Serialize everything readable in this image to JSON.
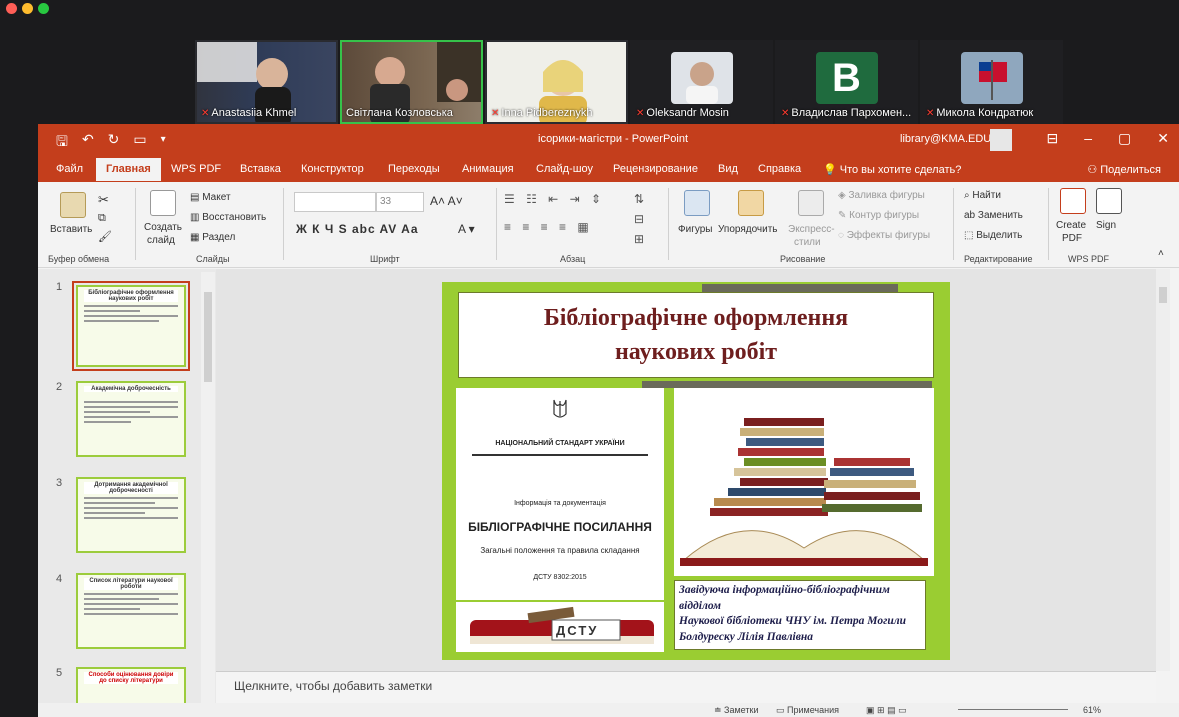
{
  "colors": {
    "ppt_accent": "#c43e1c",
    "slide_green": "#9acd32",
    "title_red": "#6e1e1e",
    "mic_off": "#ff3b30",
    "speaker_border": "#36c24a"
  },
  "participants": [
    {
      "name": "Anastasiia Khmel",
      "muted": true,
      "type": "video",
      "active": false
    },
    {
      "name": "Світлана Козловська",
      "muted": false,
      "type": "video",
      "active": true
    },
    {
      "name": "Inna Pidbereznykh",
      "muted": true,
      "type": "video",
      "active": false
    },
    {
      "name": "Oleksandr Mosin",
      "muted": true,
      "type": "photo",
      "active": false
    },
    {
      "name": "Владислав Пархомен...",
      "muted": true,
      "type": "initial",
      "initial": "B",
      "active": false
    },
    {
      "name": "Микола Кондратюк",
      "muted": true,
      "type": "photo-flag",
      "active": false
    }
  ],
  "ppt": {
    "doc_title": "ісорики-магістри - PowerPoint",
    "account": "library@KMA.EDU",
    "tabs": [
      "Файл",
      "Главная",
      "WPS PDF",
      "Вставка",
      "Конструктор",
      "Переходы",
      "Анимация",
      "Слайд-шоу",
      "Рецензирование",
      "Вид",
      "Справка"
    ],
    "active_tab": "Главная",
    "tell_me": "Что вы хотите сделать?",
    "share": "Поделиться",
    "ribbon": {
      "paste": "Вставить",
      "clipboard": "Буфер обмена",
      "new_slide_1": "Создать",
      "new_slide_2": "слайд",
      "layout": "Макет",
      "reset": "Восстановить",
      "section": "Раздел",
      "slides": "Слайды",
      "font_size": "33",
      "font": "Шрифт",
      "format_letters": "Ж  К  Ч  S  abc  AV  Aa",
      "paragraph": "Абзац",
      "shapes": "Фигуры",
      "arrange": "Упорядочить",
      "express_1": "Экспресс-",
      "express_2": "стили",
      "fill": "Заливка фигуры",
      "outline": "Контур фигуры",
      "effects": "Эффекты фигуры",
      "drawing": "Рисование",
      "find": "Найти",
      "replace": "Заменить",
      "select": "Выделить",
      "editing": "Редактирование",
      "create_pdf_1": "Create",
      "create_pdf_2": "PDF",
      "sign": "Sign",
      "wps_pdf": "WPS PDF"
    },
    "thumbnails": [
      {
        "num": "1",
        "title": "Бібліографічне оформлення наукових робіт"
      },
      {
        "num": "2",
        "title": "Академічна доброчесність"
      },
      {
        "num": "3",
        "title": "Дотримання академічної доброчесності"
      },
      {
        "num": "4",
        "title": "Список літератури наукової роботи"
      },
      {
        "num": "5",
        "title": "Способи оцінювання довіри до списку літератури"
      }
    ],
    "slide": {
      "title_line1": "Бібліографічне оформлення",
      "title_line2": "наукових робіт",
      "national_standard": "НАЦІОНАЛЬНИЙ СТАНДАРТ УКРАЇНИ",
      "info_doc": "Інформація та документація",
      "biblio_ref": "БІБЛІОГРАФІЧНЕ ПОСИЛАННЯ",
      "general": "Загальні положення та правила складання",
      "dstu_num": "ДСТУ 8302:2015",
      "dstu_label": "ДСТУ",
      "caption_line1": "Завідуюча інформаційно-бібліографічним",
      "caption_line2": "відділом",
      "caption_line3": "Наукової бібліотеки ЧНУ ім. Петра Могили",
      "caption_line4": "Болдуреску Лілія Павлівна"
    },
    "notes_placeholder": "Щелкните, чтобы добавить заметки",
    "status": {
      "notes": "Заметки",
      "comments": "Примечания",
      "zoom": "61%"
    }
  }
}
